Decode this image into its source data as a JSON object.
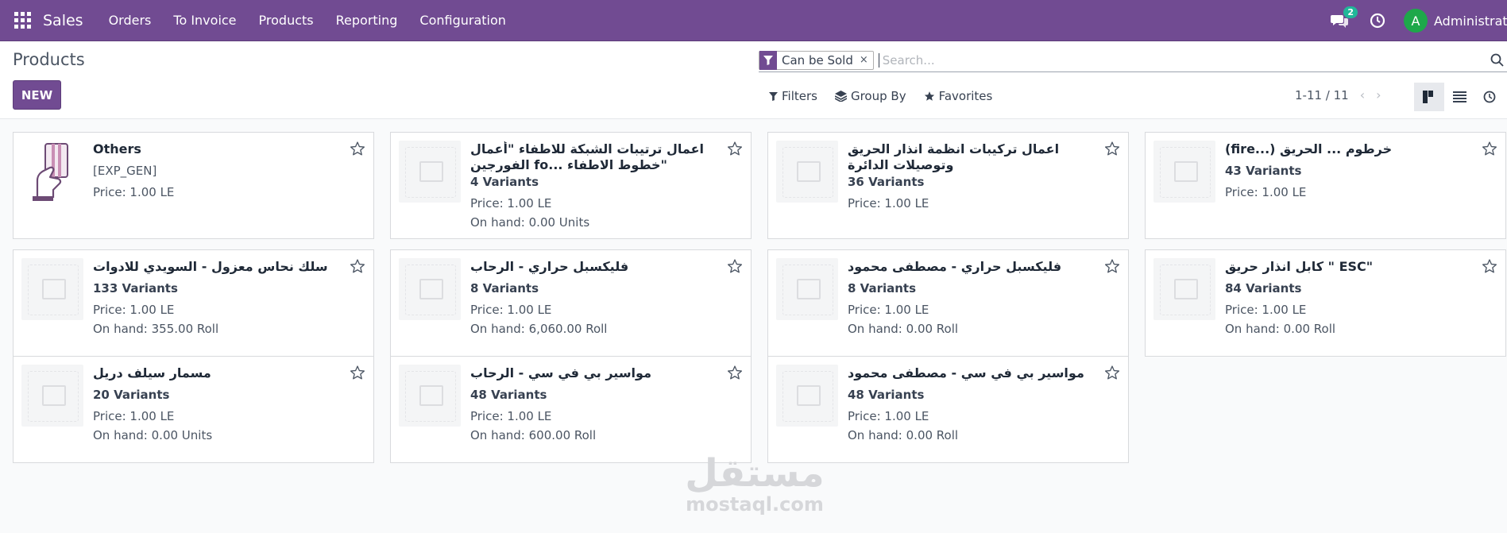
{
  "navbar": {
    "brand": "Sales",
    "menu": [
      "Orders",
      "To Invoice",
      "Products",
      "Reporting",
      "Configuration"
    ],
    "chat_count": "2",
    "avatar_letter": "A",
    "user_name": "Administrator"
  },
  "control_panel": {
    "breadcrumb": "Products",
    "new_label": "NEW",
    "facet_label": "Can be Sold",
    "facet_remove": "×",
    "search_placeholder": "Search...",
    "filters_label": "Filters",
    "groupby_label": "Group By",
    "favorites_label": "Favorites",
    "pager": "1-11 / 11",
    "pager_prev": "‹",
    "pager_next": "›"
  },
  "cards": [
    {
      "title": "Others",
      "line1": "[EXP_GEN]",
      "line1_bold": false,
      "line2": "Price: 1.00 LE",
      "line3": "",
      "image": "hand-card"
    },
    {
      "title": "اعمال ترتيبات الشبكة للاطفاء \"أعمال الفورجين fo... خطوط الاطفاء\"",
      "line1": "4 Variants",
      "line1_bold": true,
      "line2": "Price: 1.00 LE",
      "line3": "On hand: 0.00 Units",
      "image": "placeholder"
    },
    {
      "title": "اعمال تركيبات انظمة انذار الحريق وتوصيلات الدائرة",
      "line1": "36 Variants",
      "line1_bold": true,
      "line2": "Price: 1.00 LE",
      "line3": "",
      "image": "placeholder"
    },
    {
      "title": "(fire...) خرطوم ... الحريق",
      "line1": "43 Variants",
      "line1_bold": true,
      "line2": "Price: 1.00 LE",
      "line3": "",
      "image": "placeholder"
    },
    {
      "title": "سلك نحاس معزول - السويدي للادوات",
      "line1": "133 Variants",
      "line1_bold": true,
      "line2": "Price: 1.00 LE",
      "line3": "On hand: 355.00 Roll",
      "image": "placeholder"
    },
    {
      "title": "فليكسبل حراري - الرحاب",
      "line1": "8 Variants",
      "line1_bold": true,
      "line2": "Price: 1.00 LE",
      "line3": "On hand: 6,060.00 Roll",
      "image": "placeholder"
    },
    {
      "title": "فليكسبل حراري - مصطفى محمود",
      "line1": "8 Variants",
      "line1_bold": true,
      "line2": "Price: 1.00 LE",
      "line3": "On hand: 0.00 Roll",
      "image": "placeholder"
    },
    {
      "title": "كابل انذار حريق \" ESC\"",
      "line1": "84 Variants",
      "line1_bold": true,
      "line2": "Price: 1.00 LE",
      "line3": "On hand: 0.00 Roll",
      "image": "placeholder"
    },
    {
      "title": "مسمار سيلف دريل",
      "line1": "20 Variants",
      "line1_bold": true,
      "line2": "Price: 1.00 LE",
      "line3": "On hand: 0.00 Units",
      "image": "placeholder"
    },
    {
      "title": "مواسير بي في سي - الرحاب",
      "line1": "48 Variants",
      "line1_bold": true,
      "line2": "Price: 1.00 LE",
      "line3": "On hand: 600.00 Roll",
      "image": "placeholder"
    },
    {
      "title": "مواسير بي في سي - مصطفى محمود",
      "line1": "48 Variants",
      "line1_bold": true,
      "line2": "Price: 1.00 LE",
      "line3": "On hand: 0.00 Roll",
      "image": "placeholder"
    }
  ],
  "watermark": {
    "arabic": "مستقل",
    "latin": "mostaql.com"
  },
  "colors": {
    "brand": "#714b92",
    "badge": "#21b799",
    "avatar": "#1ea84a"
  }
}
